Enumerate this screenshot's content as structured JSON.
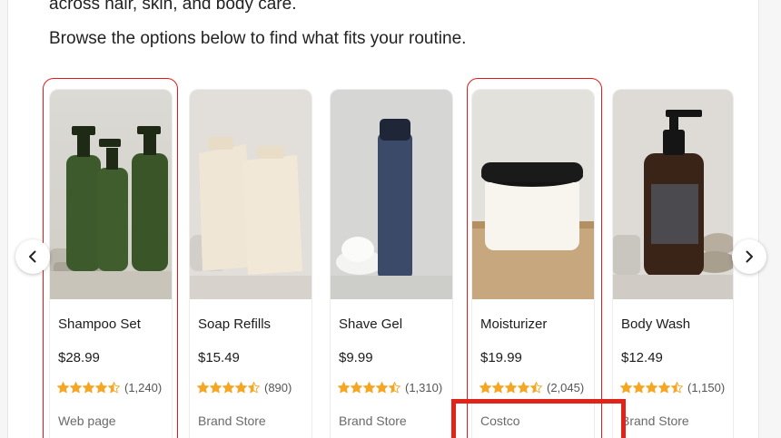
{
  "intro": {
    "partial_line": "across hair, skin, and body care.",
    "browse_line": "Browse the options below to find what fits your routine."
  },
  "carousel": {
    "prev_icon": "chevron-left-icon",
    "next_icon": "chevron-right-icon",
    "products": [
      {
        "name": "Shampoo Set",
        "price": "$28.99",
        "rating": 4.5,
        "reviews": "(1,240)",
        "source": "Web page",
        "highlighted": true,
        "image": "three-green-pump-bottles"
      },
      {
        "name": "Soap Refills",
        "price": "$15.49",
        "rating": 4.5,
        "reviews": "(890)",
        "source": "Brand Store",
        "highlighted": false,
        "image": "two-cream-refill-pouches"
      },
      {
        "name": "Shave Gel",
        "price": "$9.99",
        "rating": 4.5,
        "reviews": "(1,310)",
        "source": "Brand Store",
        "highlighted": false,
        "image": "navy-shave-gel-can"
      },
      {
        "name": "Moisturizer",
        "price": "$19.99",
        "rating": 4.5,
        "reviews": "(2,045)",
        "source": "Costco",
        "highlighted": true,
        "image": "white-jar-black-lid"
      },
      {
        "name": "Body Wash",
        "price": "$12.49",
        "rating": 4.5,
        "reviews": "(1,150)",
        "source": "Brand Store",
        "highlighted": false,
        "image": "amber-pump-bottle"
      }
    ]
  },
  "colors": {
    "highlight_red": "#e01919",
    "star": "#f5a623"
  }
}
